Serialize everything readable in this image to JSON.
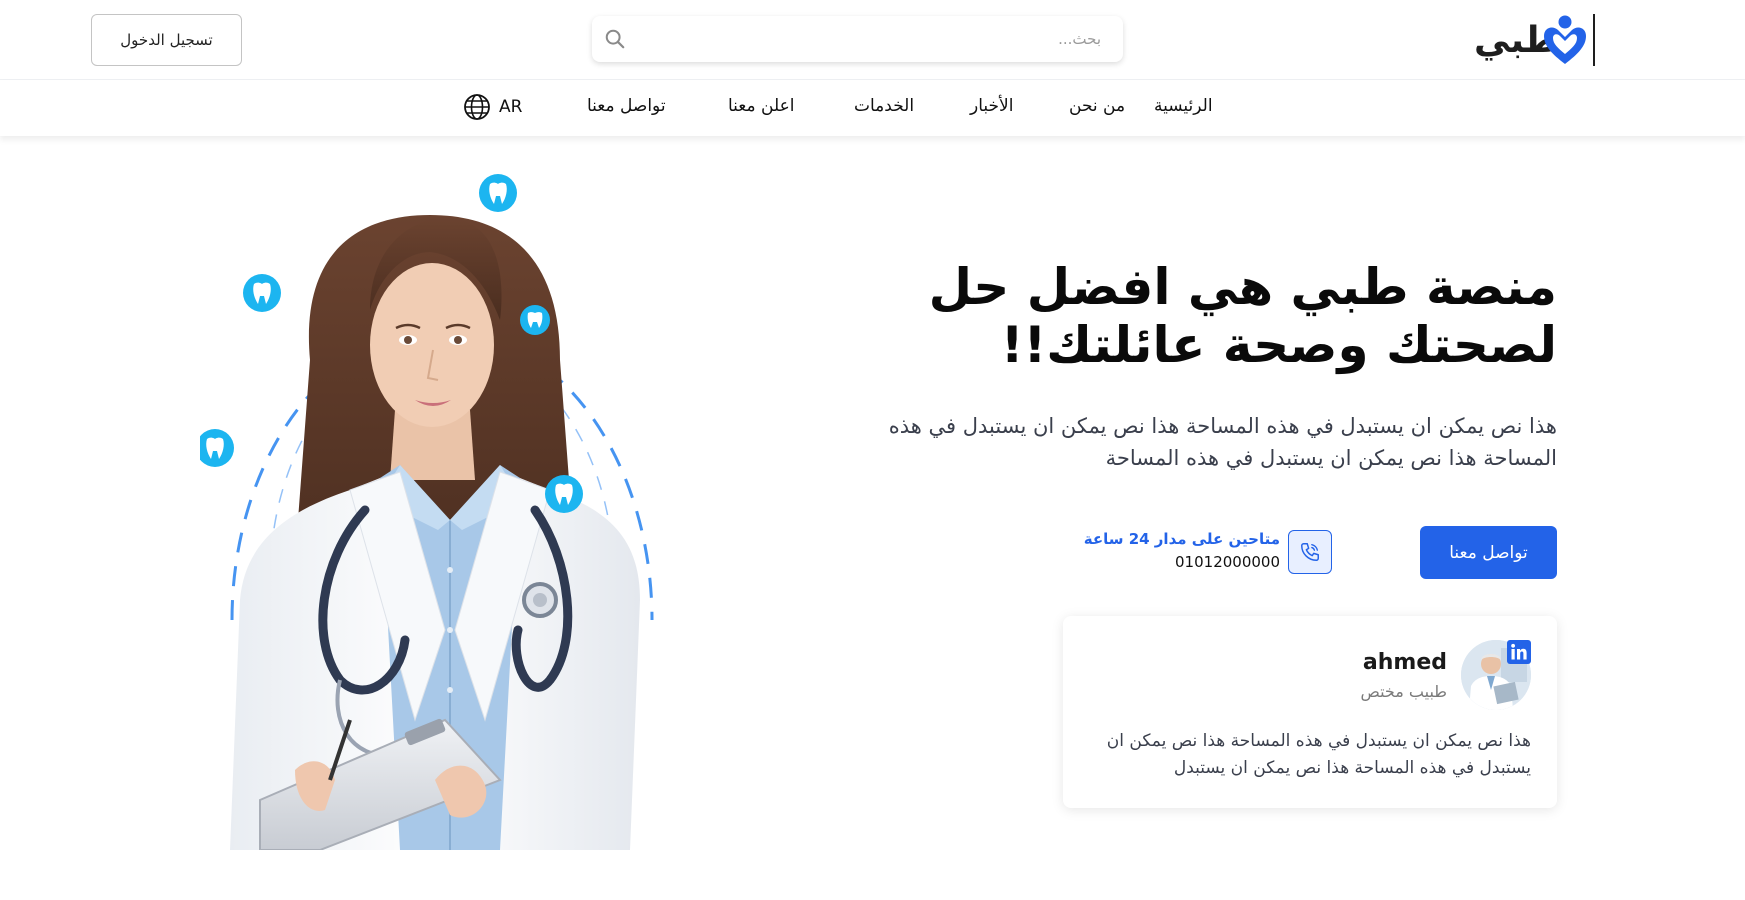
{
  "header": {
    "logo_text": "طبي",
    "search_placeholder": "بحث...",
    "login_label": "تسجيل الدخول"
  },
  "nav": {
    "items": [
      "الرئيسية",
      "من نحن",
      "الأخبار",
      "الخدمات",
      "اعلن معنا",
      "تواصل معنا"
    ],
    "language": "AR"
  },
  "hero": {
    "title_line1": "منصة طبي هي افضل حل",
    "title_line2": "لصحتك وصحة عائلتك!!",
    "description": "هذا نص يمكن ان يستبدل في هذه المساحة هذا نص يمكن ان يستبدل في هذه المساحة هذا نص يمكن ان يستبدل في هذه المساحة",
    "contact_button": "تواصل معنا",
    "availability": "متاحين على مدار 24 ساعة",
    "phone": "01012000000"
  },
  "review_card": {
    "name": "ahmed",
    "role": "طبيب مختص",
    "text": "هذا نص يمكن ان يستبدل في هذه المساحة هذا نص يمكن ان يستبدل في هذه المساحة هذا نص يمكن ان يستبدل"
  },
  "colors": {
    "primary": "#2363e8",
    "tooth_bubble": "#1cb5f0",
    "orbit": "#3c8ef0",
    "text_dark": "#0a0a0a",
    "text_muted": "#3a3f4c"
  },
  "icons": {
    "logo": "heart-hands-logo-icon",
    "search": "search-icon",
    "language": "globe-icon",
    "phone": "phone-icon",
    "social": "linkedin-icon",
    "orbit_badges": "tooth-icon"
  }
}
